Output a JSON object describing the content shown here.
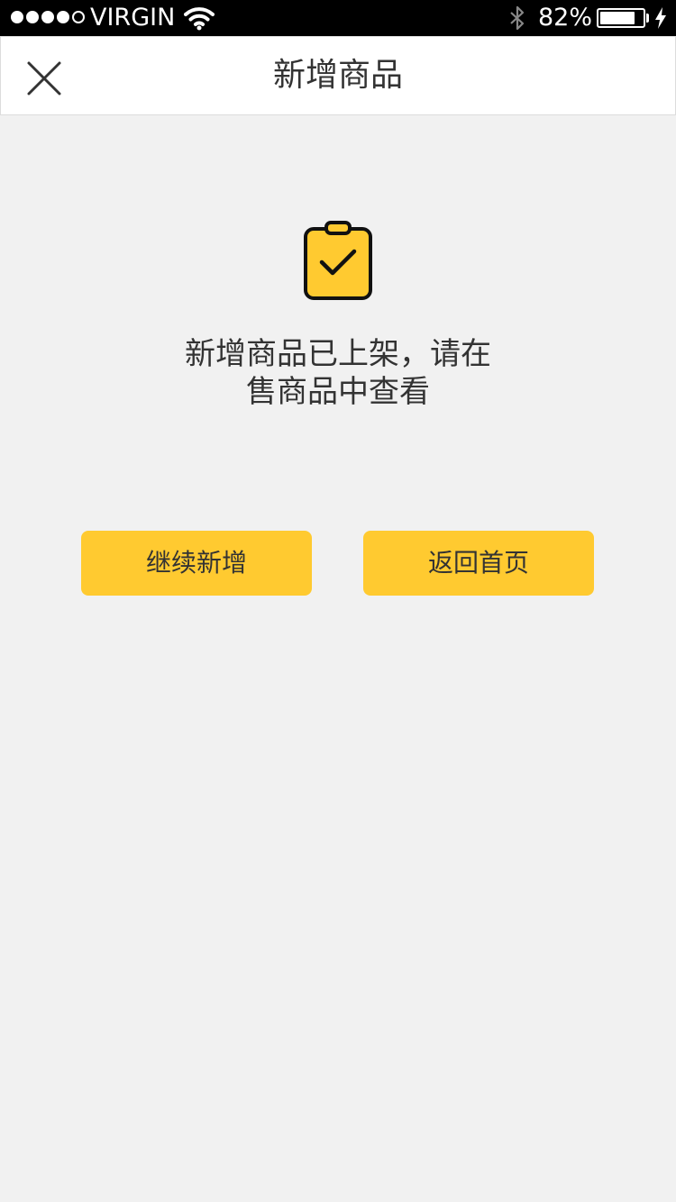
{
  "status_bar": {
    "carrier": "VIRGIN",
    "signal_filled": 4,
    "signal_total": 5,
    "battery_percent_label": "82%",
    "battery_level": 0.82,
    "icons": [
      "wifi-icon",
      "bluetooth-icon",
      "battery-icon",
      "charging-icon"
    ]
  },
  "nav": {
    "title": "新增商品",
    "close_icon": "close-icon"
  },
  "success": {
    "icon": "clipboard-check-icon",
    "message_line1": "新增商品已上架，请在",
    "message_line2": "售商品中查看"
  },
  "actions": {
    "continue_label": "继续新增",
    "home_label": "返回首页"
  },
  "colors": {
    "accent": "#ffca30",
    "background": "#f1f1f1",
    "text": "#333333"
  }
}
